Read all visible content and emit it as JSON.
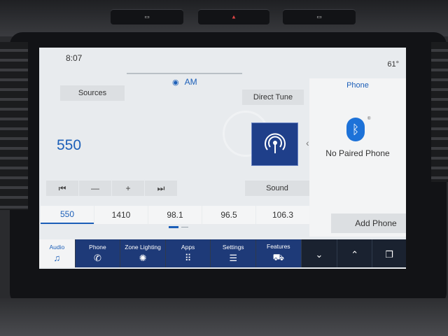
{
  "status": {
    "time": "8:07",
    "temperature": "61°"
  },
  "radio": {
    "band_label": "AM",
    "sources_label": "Sources",
    "direct_tune_label": "Direct Tune",
    "frequency": "550",
    "sound_label": "Sound",
    "controls": [
      {
        "name": "seek-back",
        "symbol": "⏮"
      },
      {
        "name": "minus",
        "symbol": "—"
      },
      {
        "name": "plus",
        "symbol": "+"
      },
      {
        "name": "seek-forward",
        "symbol": "⏭"
      }
    ],
    "presets": [
      "550",
      "1410",
      "98.1",
      "96.5",
      "106.3"
    ],
    "active_preset_index": 0
  },
  "phone_panel": {
    "title": "Phone",
    "status": "No Paired Phone",
    "add_button": "Add Phone",
    "icon": "bluetooth-icon"
  },
  "nav": {
    "items": [
      {
        "label": "Audio",
        "icon": "music-note-icon"
      },
      {
        "label": "Phone",
        "icon": "phone-icon"
      },
      {
        "label": "Zone Lighting",
        "icon": "zone-lighting-icon"
      },
      {
        "label": "Apps",
        "icon": "apps-grid-icon"
      },
      {
        "label": "Settings",
        "icon": "settings-sliders-icon"
      },
      {
        "label": "Features",
        "icon": "truck-icon"
      }
    ],
    "right_buttons": [
      {
        "icon": "chevron-down-icon"
      },
      {
        "icon": "chevron-up-icon"
      },
      {
        "icon": "copy-icon"
      }
    ]
  },
  "colors": {
    "accent": "#1c5fb8",
    "nav_bg": "#1a2230",
    "screen_bg": "#e8ebee"
  }
}
